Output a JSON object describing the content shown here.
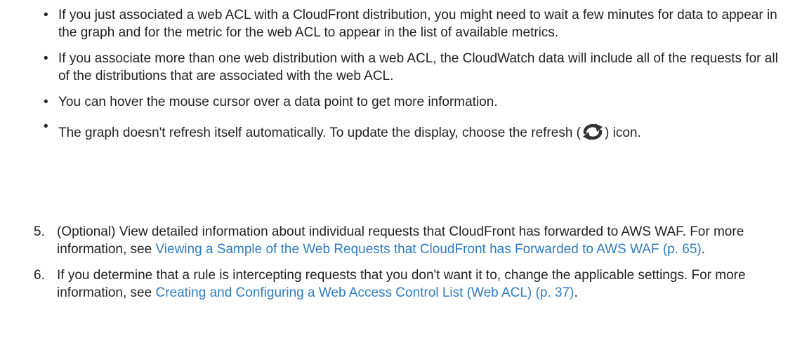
{
  "bullet_glyph": "•",
  "bullets": [
    {
      "text": "If you just associated a web ACL with a CloudFront distribution, you might need to wait a few minutes for data to appear in the graph and for the metric for the web ACL to appear in the list of available metrics."
    },
    {
      "text": "If you associate more than one web distribution with a web ACL, the CloudWatch data will include all of the requests for all of the distributions that are associated with the web ACL."
    },
    {
      "text": "You can hover the mouse cursor over a data point to get more information."
    },
    {
      "text_before": "The graph doesn't refresh itself automatically. To update the display, choose the refresh (",
      "icon": "refresh-icon",
      "text_after": ") icon."
    }
  ],
  "steps": [
    {
      "number": "5.",
      "text": "(Optional) View detailed information about individual requests that CloudFront has forwarded to AWS WAF. For more information, see ",
      "link": "Viewing a Sample of the Web Requests that CloudFront has Forwarded to AWS WAF (p. 65)",
      "after": "."
    },
    {
      "number": "6.",
      "text": "If you determine that a rule is intercepting requests that you don't want it to, change the applicable settings. For more information, see ",
      "link": "Creating and Configuring a Web Access Control List (Web ACL) (p. 37)",
      "after": "."
    }
  ],
  "colors": {
    "text": "#222222",
    "link": "#2f7bbf",
    "icon": "#333333"
  }
}
